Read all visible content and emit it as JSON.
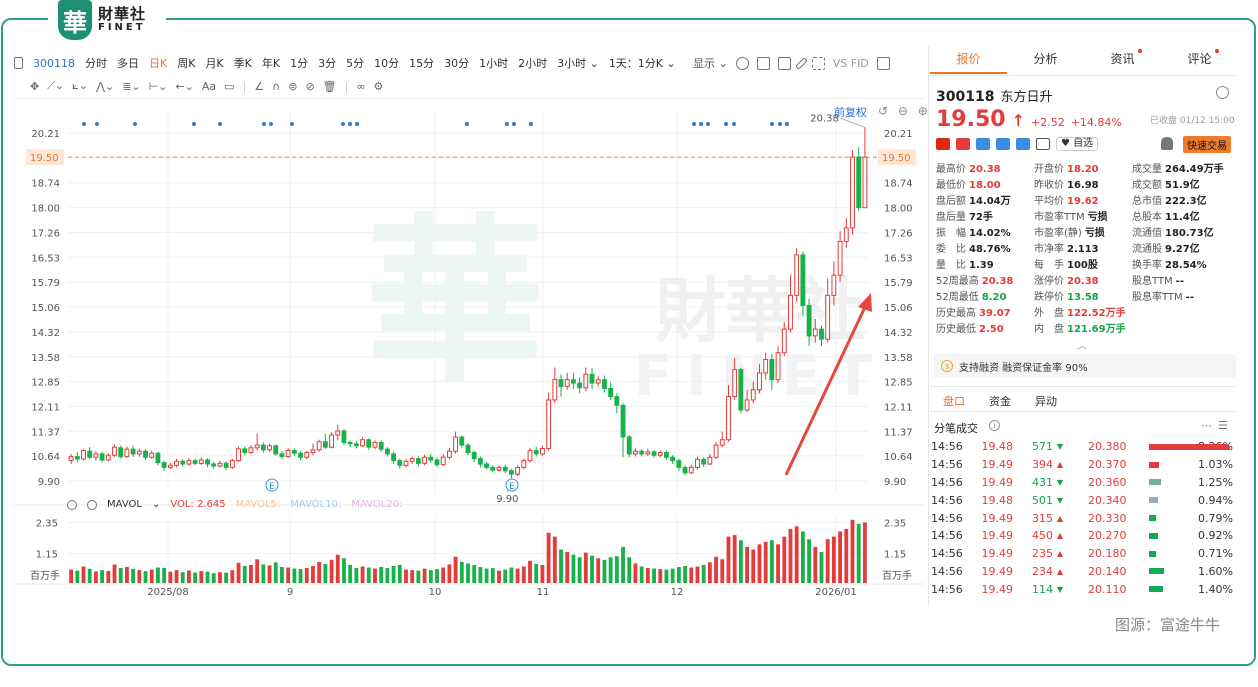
{
  "brand": {
    "badge": "華",
    "cn": "財華社",
    "en": "FINET"
  },
  "toolbar": {
    "code": "300118",
    "periods": [
      "分时",
      "多日",
      "日K",
      "周K",
      "月K",
      "季K",
      "年K",
      "1分",
      "3分",
      "5分",
      "10分",
      "15分",
      "30分",
      "1小时",
      "2小时",
      "3小时 ⌄",
      "1天：1分K ⌄"
    ],
    "active_period": "日K",
    "display": "显示 ⌄",
    "right_text": "VS FID"
  },
  "chart_controls": {
    "fq": "前复权",
    "icons": "↺ ⊖ ⊕"
  },
  "mavol": {
    "label": "MAVOL",
    "vol": "VOL: 2.645",
    "ma5": "MAVOL5:",
    "ma10": "MAVOL10:",
    "ma20": "MAVOL20:"
  },
  "colors": {
    "up": "#e23c3c",
    "down": "#17b24a",
    "accent": "#e8762c",
    "link": "#2a6fd6",
    "border": "#2aa37f"
  },
  "chart_data": {
    "type": "candlestick",
    "price_axis_left": [
      "20.21",
      "19.50",
      "18.74",
      "18.00",
      "17.26",
      "16.53",
      "15.79",
      "15.06",
      "14.32",
      "13.58",
      "12.85",
      "12.11",
      "11.37",
      "10.64",
      "9.90"
    ],
    "price_axis_right": [
      "20.21",
      "19.50",
      "18.74",
      "18.00",
      "17.26",
      "16.53",
      "15.79",
      "15.06",
      "14.32",
      "13.58",
      "12.85",
      "12.11",
      "11.37",
      "10.64",
      "9.90"
    ],
    "ylim": [
      9.6,
      20.6
    ],
    "current_price_line": 19.5,
    "high_label": "20.38",
    "low_label": "9.90",
    "x_labels": [
      "2025/08",
      "9",
      "10",
      "11",
      "12",
      "2026/01"
    ],
    "volume_axis": [
      "2.35",
      "1.15"
    ],
    "volume_unit": "百万手",
    "ohlc": [
      [
        10.5,
        10.62,
        10.4,
        10.7
      ],
      [
        10.62,
        10.55,
        10.45,
        10.75
      ],
      [
        10.55,
        10.8,
        10.5,
        10.85
      ],
      [
        10.78,
        10.6,
        10.55,
        10.9
      ],
      [
        10.6,
        10.7,
        10.5,
        10.78
      ],
      [
        10.7,
        10.52,
        10.45,
        10.76
      ],
      [
        10.52,
        10.66,
        10.48,
        10.72
      ],
      [
        10.66,
        10.9,
        10.6,
        10.98
      ],
      [
        10.88,
        10.62,
        10.56,
        10.95
      ],
      [
        10.62,
        10.84,
        10.58,
        10.92
      ],
      [
        10.84,
        10.7,
        10.6,
        10.95
      ],
      [
        10.7,
        10.78,
        10.62,
        10.86
      ],
      [
        10.78,
        10.6,
        10.52,
        10.84
      ],
      [
        10.6,
        10.72,
        10.55,
        10.8
      ],
      [
        10.72,
        10.44,
        10.36,
        10.76
      ],
      [
        10.44,
        10.3,
        10.2,
        10.5
      ],
      [
        10.3,
        10.36,
        10.25,
        10.44
      ],
      [
        10.36,
        10.48,
        10.3,
        10.55
      ],
      [
        10.48,
        10.4,
        10.32,
        10.54
      ],
      [
        10.4,
        10.5,
        10.34,
        10.58
      ],
      [
        10.5,
        10.42,
        10.36,
        10.56
      ],
      [
        10.42,
        10.52,
        10.38,
        10.6
      ],
      [
        10.52,
        10.4,
        10.3,
        10.58
      ],
      [
        10.4,
        10.34,
        10.26,
        10.46
      ],
      [
        10.34,
        10.42,
        10.3,
        10.5
      ],
      [
        10.42,
        10.3,
        10.22,
        10.48
      ],
      [
        10.3,
        10.5,
        10.26,
        10.56
      ],
      [
        10.5,
        10.85,
        10.46,
        10.92
      ],
      [
        10.85,
        10.74,
        10.66,
        10.92
      ],
      [
        10.74,
        10.88,
        10.7,
        10.96
      ],
      [
        10.88,
        10.96,
        10.8,
        11.3
      ],
      [
        10.96,
        10.82,
        10.74,
        11.04
      ],
      [
        10.82,
        10.94,
        10.76,
        11.0
      ],
      [
        10.94,
        10.7,
        10.64,
        10.98
      ],
      [
        10.7,
        10.62,
        10.54,
        10.78
      ],
      [
        10.62,
        10.8,
        10.58,
        10.88
      ],
      [
        10.8,
        10.72,
        10.64,
        10.86
      ],
      [
        10.72,
        10.6,
        10.5,
        10.78
      ],
      [
        10.6,
        10.74,
        10.54,
        10.8
      ],
      [
        10.74,
        10.82,
        10.66,
        11.0
      ],
      [
        10.82,
        11.06,
        10.76,
        11.12
      ],
      [
        11.06,
        10.9,
        10.84,
        11.3
      ],
      [
        10.9,
        11.26,
        10.86,
        11.34
      ],
      [
        11.26,
        11.38,
        11.1,
        11.56
      ],
      [
        11.38,
        11.04,
        10.96,
        11.44
      ],
      [
        11.04,
        11.0,
        10.9,
        11.1
      ],
      [
        11.0,
        10.94,
        10.86,
        11.08
      ],
      [
        10.94,
        11.12,
        10.9,
        11.2
      ],
      [
        11.12,
        10.9,
        10.82,
        11.16
      ],
      [
        10.9,
        11.04,
        10.84,
        11.1
      ],
      [
        11.04,
        10.84,
        10.76,
        11.1
      ],
      [
        10.84,
        10.7,
        10.62,
        10.9
      ],
      [
        10.7,
        10.5,
        10.4,
        10.76
      ],
      [
        10.5,
        10.36,
        10.26,
        10.56
      ],
      [
        10.36,
        10.48,
        10.3,
        10.56
      ],
      [
        10.48,
        10.56,
        10.4,
        10.62
      ],
      [
        10.56,
        10.42,
        10.34,
        10.64
      ],
      [
        10.42,
        10.6,
        10.36,
        10.68
      ],
      [
        10.6,
        10.52,
        10.44,
        10.7
      ],
      [
        10.52,
        10.38,
        10.3,
        10.6
      ],
      [
        10.38,
        10.6,
        10.34,
        10.7
      ],
      [
        10.6,
        10.78,
        10.54,
        10.88
      ],
      [
        10.78,
        11.2,
        10.7,
        11.36
      ],
      [
        11.2,
        10.96,
        10.88,
        11.24
      ],
      [
        10.96,
        10.74,
        10.66,
        11.02
      ],
      [
        10.74,
        10.56,
        10.46,
        10.8
      ],
      [
        10.56,
        10.4,
        10.3,
        10.62
      ],
      [
        10.4,
        10.3,
        10.24,
        10.46
      ],
      [
        10.3,
        10.22,
        10.14,
        10.36
      ],
      [
        10.22,
        10.3,
        10.16,
        10.36
      ],
      [
        10.3,
        10.2,
        10.12,
        10.38
      ],
      [
        10.2,
        10.1,
        9.98,
        10.26
      ],
      [
        10.1,
        10.3,
        10.04,
        10.36
      ],
      [
        10.3,
        10.5,
        10.24,
        10.56
      ],
      [
        10.5,
        10.8,
        10.44,
        10.88
      ],
      [
        10.8,
        10.7,
        10.62,
        10.92
      ],
      [
        10.7,
        10.86,
        10.64,
        10.94
      ],
      [
        10.86,
        12.3,
        10.8,
        12.52
      ],
      [
        12.3,
        12.9,
        12.2,
        13.26
      ],
      [
        12.9,
        12.7,
        12.4,
        13.06
      ],
      [
        12.7,
        12.9,
        12.6,
        13.1
      ],
      [
        12.9,
        12.8,
        12.62,
        13.1
      ],
      [
        12.8,
        12.66,
        12.5,
        12.96
      ],
      [
        12.66,
        13.06,
        12.56,
        13.26
      ],
      [
        13.06,
        12.8,
        12.62,
        13.24
      ],
      [
        12.8,
        12.9,
        12.7,
        13.0
      ],
      [
        12.9,
        12.64,
        12.52,
        13.02
      ],
      [
        12.64,
        12.4,
        12.3,
        12.84
      ],
      [
        12.4,
        12.14,
        11.9,
        12.5
      ],
      [
        12.14,
        11.2,
        10.6,
        12.2
      ],
      [
        11.2,
        10.7,
        10.6,
        11.26
      ],
      [
        10.7,
        10.78,
        10.62,
        10.86
      ],
      [
        10.78,
        10.7,
        10.62,
        10.84
      ],
      [
        10.7,
        10.76,
        10.64,
        10.86
      ],
      [
        10.76,
        10.66,
        10.58,
        10.82
      ],
      [
        10.66,
        10.74,
        10.6,
        10.8
      ],
      [
        10.74,
        10.6,
        10.52,
        10.8
      ],
      [
        10.6,
        10.5,
        10.4,
        10.66
      ],
      [
        10.5,
        10.3,
        10.2,
        10.56
      ],
      [
        10.3,
        10.14,
        10.06,
        10.36
      ],
      [
        10.14,
        10.3,
        10.1,
        10.38
      ],
      [
        10.3,
        10.54,
        10.24,
        10.62
      ],
      [
        10.54,
        10.4,
        10.32,
        10.6
      ],
      [
        10.4,
        10.6,
        10.36,
        10.7
      ],
      [
        10.6,
        10.96,
        10.54,
        11.06
      ],
      [
        10.96,
        11.12,
        10.9,
        11.36
      ],
      [
        11.12,
        12.4,
        11.06,
        12.74
      ],
      [
        12.4,
        13.2,
        12.3,
        13.54
      ],
      [
        13.2,
        12.0,
        11.9,
        13.26
      ],
      [
        12.0,
        12.3,
        11.94,
        12.6
      ],
      [
        12.3,
        12.6,
        12.2,
        12.84
      ],
      [
        12.6,
        13.1,
        12.5,
        13.36
      ],
      [
        13.1,
        13.5,
        12.9,
        13.7
      ],
      [
        13.5,
        12.9,
        12.6,
        13.66
      ],
      [
        12.9,
        13.7,
        12.8,
        13.9
      ],
      [
        13.7,
        14.4,
        13.6,
        14.6
      ],
      [
        14.4,
        15.4,
        14.3,
        16.0
      ],
      [
        15.4,
        16.6,
        15.2,
        16.8
      ],
      [
        16.6,
        15.1,
        14.8,
        16.7
      ],
      [
        15.1,
        14.2,
        13.9,
        15.3
      ],
      [
        14.2,
        14.4,
        14.0,
        14.7
      ],
      [
        14.4,
        14.1,
        13.9,
        14.5
      ],
      [
        14.1,
        15.4,
        14.0,
        15.9
      ],
      [
        15.4,
        16.0,
        15.1,
        16.4
      ],
      [
        16.0,
        17.0,
        15.8,
        17.3
      ],
      [
        17.0,
        17.4,
        16.8,
        17.7
      ],
      [
        17.4,
        19.5,
        17.2,
        19.7
      ],
      [
        19.5,
        18.0,
        17.9,
        19.8
      ],
      [
        18.0,
        19.5,
        18.0,
        20.38
      ]
    ],
    "volume": [
      0.52,
      0.48,
      0.64,
      0.55,
      0.45,
      0.5,
      0.47,
      0.72,
      0.58,
      0.62,
      0.55,
      0.5,
      0.46,
      0.52,
      0.6,
      0.58,
      0.44,
      0.5,
      0.42,
      0.48,
      0.4,
      0.46,
      0.44,
      0.38,
      0.42,
      0.4,
      0.5,
      0.78,
      0.66,
      0.7,
      0.92,
      0.72,
      0.68,
      0.8,
      0.62,
      0.6,
      0.56,
      0.54,
      0.58,
      0.66,
      0.82,
      0.74,
      0.9,
      1.1,
      0.96,
      0.7,
      0.58,
      0.64,
      0.6,
      0.56,
      0.62,
      0.58,
      0.66,
      0.7,
      0.52,
      0.5,
      0.48,
      0.56,
      0.5,
      0.54,
      0.6,
      0.72,
      1.02,
      0.82,
      0.76,
      0.7,
      0.62,
      0.56,
      0.58,
      0.48,
      0.52,
      0.6,
      0.56,
      0.64,
      0.86,
      0.74,
      0.7,
      1.95,
      1.8,
      1.3,
      1.2,
      1.1,
      1.0,
      1.18,
      1.06,
      0.96,
      0.9,
      1.0,
      1.04,
      1.4,
      1.0,
      0.76,
      0.64,
      0.58,
      0.56,
      0.54,
      0.52,
      0.56,
      0.62,
      0.66,
      0.6,
      0.64,
      0.7,
      0.8,
      1.02,
      0.92,
      1.8,
      1.86,
      1.66,
      1.4,
      1.3,
      1.5,
      1.6,
      1.66,
      1.5,
      1.8,
      2.1,
      2.2,
      2.0,
      1.7,
      1.4,
      1.2,
      1.7,
      1.8,
      2.0,
      2.1,
      2.45,
      2.3,
      2.35
    ]
  },
  "panel": {
    "tabs": [
      "报价",
      "分析",
      "资讯",
      "评论"
    ],
    "code": "300118",
    "name": "东方日升",
    "price": "19.50",
    "arrow": "↑",
    "change": "+2.52",
    "change_pct": "+14.84%",
    "closed": "已收盘 01/12 15:00",
    "watch": "♥ 自选",
    "quick_trade": "快速交易",
    "quotes": [
      [
        "最高价",
        "20.38",
        "r"
      ],
      [
        "开盘价",
        "18.20",
        "r"
      ],
      [
        "成交量",
        "264.49万手",
        ""
      ],
      [
        "最低价",
        "18.00",
        "r"
      ],
      [
        "昨收价",
        "16.98",
        ""
      ],
      [
        "成交额",
        "51.9亿",
        ""
      ],
      [
        "盘后额",
        "14.04万",
        ""
      ],
      [
        "平均价",
        "19.62",
        "r"
      ],
      [
        "总市值",
        "222.3亿",
        ""
      ],
      [
        "盘后量",
        "72手",
        ""
      ],
      [
        "市盈率TTM",
        "亏损",
        ""
      ],
      [
        "总股本",
        "11.4亿",
        ""
      ],
      [
        "振　幅",
        "14.02%",
        ""
      ],
      [
        "市盈率(静)",
        "亏损",
        ""
      ],
      [
        "流通值",
        "180.73亿",
        ""
      ],
      [
        "委　比",
        "48.76%",
        ""
      ],
      [
        "市净率",
        "2.113",
        ""
      ],
      [
        "流通股",
        "9.27亿",
        ""
      ],
      [
        "量　比",
        "1.39",
        ""
      ],
      [
        "每　手",
        "100股",
        ""
      ],
      [
        "换手率",
        "28.54%",
        ""
      ],
      [
        "52周最高",
        "20.38",
        "r"
      ],
      [
        "涨停价",
        "20.38",
        "r"
      ],
      [
        "股息TTM",
        "--",
        ""
      ],
      [
        "52周最低",
        "8.20",
        "g"
      ],
      [
        "跌停价",
        "13.58",
        "g"
      ],
      [
        "股息率TTM",
        "--",
        ""
      ],
      [
        "历史最高",
        "39.07",
        "r"
      ],
      [
        "外　盘",
        "122.52万手",
        "r"
      ],
      [
        "",
        "",
        " "
      ],
      [
        "历史最低",
        "2.50",
        "r"
      ],
      [
        "内　盘",
        "121.69万手",
        "g"
      ],
      [
        "",
        "",
        " "
      ]
    ],
    "margin": "支持融资 融资保证金率 90%",
    "subtabs": [
      "盘口",
      "资金",
      "异动"
    ],
    "fbcj": "分笔成交",
    "ticks": [
      [
        "14:56",
        "19.48",
        "571",
        "g"
      ],
      [
        "14:56",
        "19.49",
        "394",
        "r"
      ],
      [
        "14:56",
        "19.49",
        "431",
        "g"
      ],
      [
        "14:56",
        "19.48",
        "501",
        "g"
      ],
      [
        "14:56",
        "19.49",
        "315",
        "r"
      ],
      [
        "14:56",
        "19.49",
        "450",
        "r"
      ],
      [
        "14:56",
        "19.49",
        "235",
        "r"
      ],
      [
        "14:56",
        "19.49",
        "234",
        "r"
      ],
      [
        "14:56",
        "19.49",
        "114",
        "g"
      ]
    ],
    "levels": [
      [
        "20.380",
        "8.26%",
        1.0,
        "#e23c3c"
      ],
      [
        "20.370",
        "1.03%",
        0.12,
        "#e23c3c"
      ],
      [
        "20.360",
        "1.25%",
        0.15,
        "#7a9"
      ],
      [
        "20.340",
        "0.94%",
        0.11,
        "#9ab"
      ],
      [
        "20.330",
        "0.79%",
        0.09,
        "#1a5"
      ],
      [
        "20.270",
        "0.92%",
        0.11,
        "#1a5"
      ],
      [
        "20.180",
        "0.71%",
        0.08,
        "#1a5"
      ],
      [
        "20.140",
        "1.60%",
        0.19,
        "#1a5"
      ],
      [
        "20.110",
        "1.40%",
        0.17,
        "#1a5"
      ]
    ]
  },
  "credit": "图源：富途牛牛"
}
